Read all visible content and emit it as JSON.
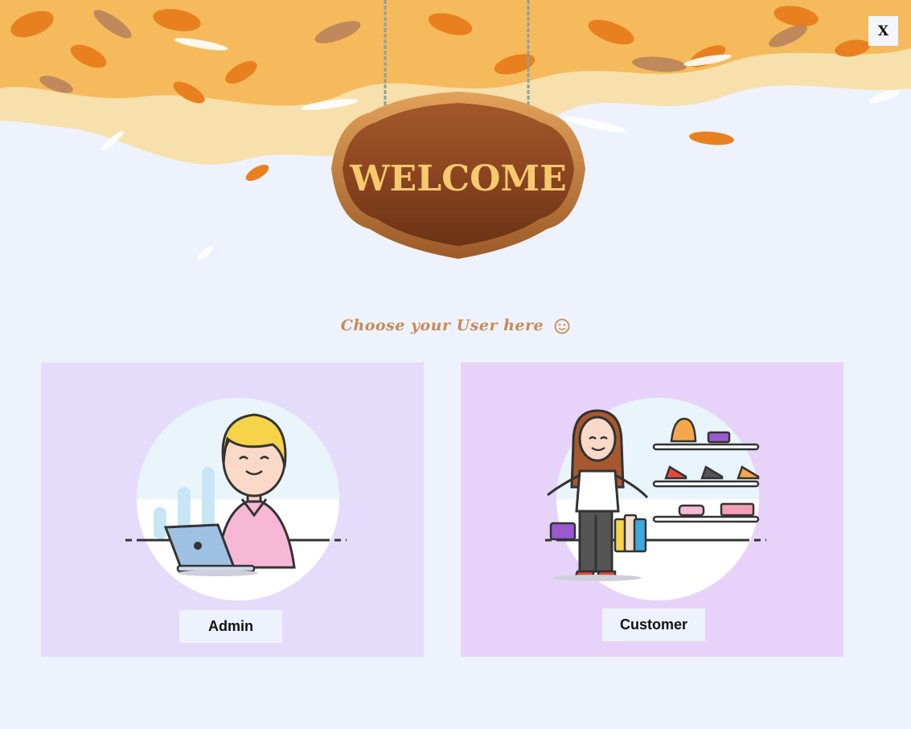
{
  "window": {
    "close_label": "X",
    "sign_text": "WELCOME",
    "prompt_text": "Choose your User here",
    "prompt_emoji": "wink-emoji"
  },
  "users": {
    "admin": {
      "label": "Admin",
      "icon": "admin-laptop-illustration"
    },
    "customer": {
      "label": "Customer",
      "icon": "shopper-illustration"
    }
  },
  "colors": {
    "background": "#eef2fd",
    "admin_card": "#e5dcfb",
    "customer_card": "#e7d3fa",
    "prompt": "#c98a55",
    "sign_text": "#f7c96e"
  }
}
